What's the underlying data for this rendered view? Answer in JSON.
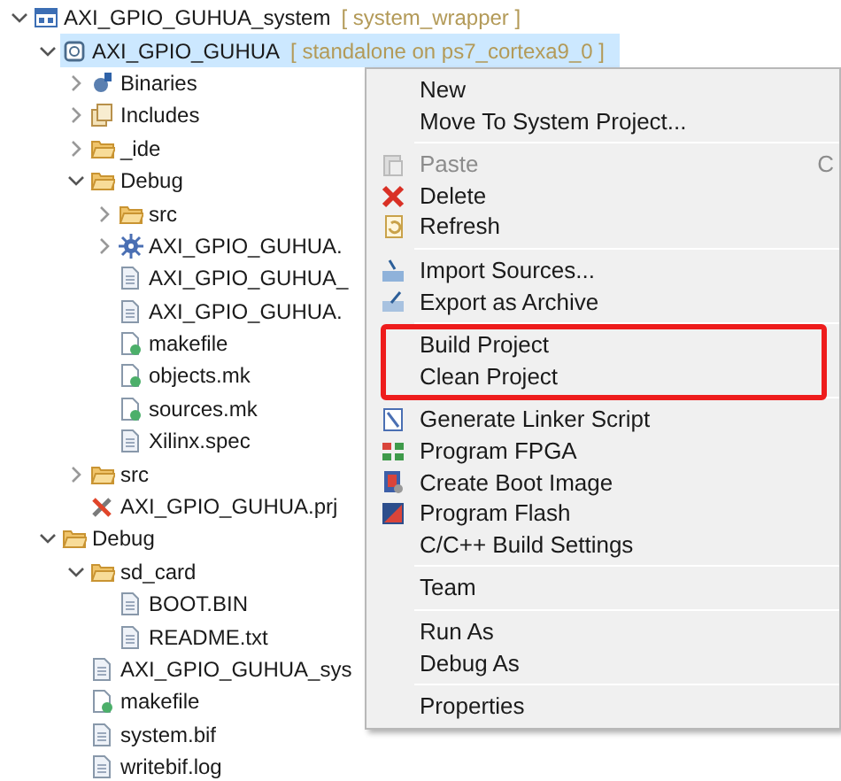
{
  "tree": [
    {
      "label": "AXI_GPIO_GUHUA_system",
      "decoration": "[ system_wrapper ]",
      "kind": "system",
      "expanded": true,
      "selected": false,
      "children": [
        {
          "label": "AXI_GPIO_GUHUA",
          "decoration": "[ standalone on ps7_cortexa9_0 ]",
          "kind": "project",
          "expanded": true,
          "selected": true,
          "children": [
            {
              "label": "Binaries",
              "kind": "binaries",
              "expanded": false,
              "selected": false
            },
            {
              "label": "Includes",
              "kind": "includes",
              "expanded": false,
              "selected": false
            },
            {
              "label": "_ide",
              "kind": "folder",
              "expanded": false,
              "selected": false
            },
            {
              "label": "Debug",
              "kind": "folder",
              "expanded": true,
              "selected": false,
              "children": [
                {
                  "label": "src",
                  "kind": "folder",
                  "expanded": false,
                  "selected": false
                },
                {
                  "label": "AXI_GPIO_GUHUA.",
                  "kind": "bug",
                  "expanded": false,
                  "selected": false
                },
                {
                  "label": "AXI_GPIO_GUHUA_",
                  "kind": "file",
                  "selected": false
                },
                {
                  "label": "AXI_GPIO_GUHUA.",
                  "kind": "file",
                  "selected": false
                },
                {
                  "label": "makefile",
                  "kind": "makefile",
                  "selected": false
                },
                {
                  "label": "objects.mk",
                  "kind": "makefile",
                  "selected": false
                },
                {
                  "label": "sources.mk",
                  "kind": "makefile",
                  "selected": false
                },
                {
                  "label": "Xilinx.spec",
                  "kind": "file",
                  "selected": false
                }
              ]
            },
            {
              "label": "src",
              "kind": "folder",
              "expanded": false,
              "selected": false
            },
            {
              "label": "AXI_GPIO_GUHUA.prj",
              "kind": "prj",
              "selected": false
            }
          ]
        },
        {
          "label": "Debug",
          "kind": "folder",
          "expanded": true,
          "selected": false,
          "children": [
            {
              "label": "sd_card",
              "kind": "folder",
              "expanded": true,
              "selected": false,
              "children": [
                {
                  "label": "BOOT.BIN",
                  "kind": "file",
                  "selected": false
                },
                {
                  "label": "README.txt",
                  "kind": "file",
                  "selected": false
                }
              ]
            },
            {
              "label": "AXI_GPIO_GUHUA_sys",
              "kind": "file",
              "selected": false
            },
            {
              "label": "makefile",
              "kind": "makefile",
              "selected": false
            },
            {
              "label": "system.bif",
              "kind": "file",
              "selected": false
            },
            {
              "label": "writebif.log",
              "kind": "file",
              "selected": false
            }
          ]
        }
      ]
    }
  ],
  "context_menu": {
    "groups": [
      {
        "annotated": false,
        "items": [
          {
            "label": "New",
            "disabled": false
          },
          {
            "label": "Move To System Project...",
            "disabled": false
          }
        ]
      },
      {
        "annotated": false,
        "items": [
          {
            "label": "Paste",
            "kind": "paste",
            "disabled": true,
            "shortcut": "C"
          },
          {
            "label": "Delete",
            "kind": "delete",
            "disabled": false
          },
          {
            "label": "Refresh",
            "kind": "refresh",
            "disabled": false
          }
        ]
      },
      {
        "annotated": false,
        "items": [
          {
            "label": "Import Sources...",
            "kind": "import",
            "disabled": false
          },
          {
            "label": "Export as Archive",
            "kind": "export",
            "disabled": false
          }
        ]
      },
      {
        "annotated": true,
        "items": [
          {
            "label": "Build Project",
            "disabled": false
          },
          {
            "label": "Clean Project",
            "disabled": false
          }
        ]
      },
      {
        "annotated": false,
        "items": [
          {
            "label": "Generate Linker Script",
            "kind": "linker",
            "disabled": false
          },
          {
            "label": "Program FPGA",
            "kind": "fpga",
            "disabled": false
          },
          {
            "label": "Create Boot Image",
            "kind": "boot",
            "disabled": false
          },
          {
            "label": "Program Flash",
            "kind": "flash",
            "disabled": false
          },
          {
            "label": "C/C++ Build Settings",
            "disabled": false
          }
        ]
      },
      {
        "annotated": false,
        "items": [
          {
            "label": "Team",
            "disabled": false
          }
        ]
      },
      {
        "annotated": false,
        "items": [
          {
            "label": "Run As",
            "disabled": false
          },
          {
            "label": "Debug As",
            "disabled": false
          }
        ]
      },
      {
        "annotated": false,
        "items": [
          {
            "label": "Properties",
            "disabled": false
          }
        ]
      }
    ]
  }
}
